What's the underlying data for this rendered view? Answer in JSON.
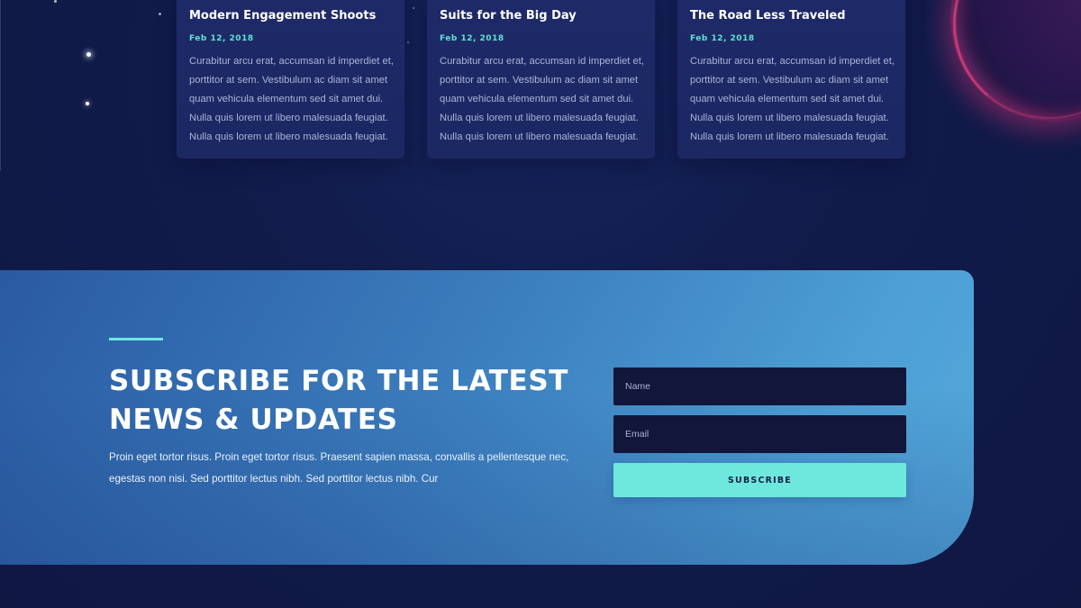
{
  "cards": [
    {
      "title": "Modern Engagement Shoots",
      "date": "Feb 12, 2018",
      "text": "Curabitur arcu erat, accumsan id imperdiet et, porttitor at sem. Vestibulum ac diam sit amet quam vehicula elementum sed sit amet dui. Nulla quis lorem ut libero malesuada feugiat. Nulla quis lorem ut libero malesuada feugiat."
    },
    {
      "title": "Suits for the Big Day",
      "date": "Feb 12, 2018",
      "text": "Curabitur arcu erat, accumsan id imperdiet et, porttitor at sem. Vestibulum ac diam sit amet quam vehicula elementum sed sit amet dui. Nulla quis lorem ut libero malesuada feugiat. Nulla quis lorem ut libero malesuada feugiat."
    },
    {
      "title": "The Road Less Traveled",
      "date": "Feb 12, 2018",
      "text": "Curabitur arcu erat, accumsan id imperdiet et, porttitor at sem. Vestibulum ac diam sit amet quam vehicula elementum sed sit amet dui. Nulla quis lorem ut libero malesuada feugiat. Nulla quis lorem ut libero malesuada feugiat."
    }
  ],
  "subscribe": {
    "heading": "SUBSCRIBE FOR THE LATEST NEWS & UPDATES",
    "text": "Proin eget tortor risus. Proin eget tortor risus. Praesent sapien massa, convallis a pellentesque nec, egestas non nisi. Sed porttitor lectus nibh. Sed porttitor lectus nibh. Cur",
    "name_placeholder": "Name",
    "email_placeholder": "Email",
    "button_label": "SUBSCRIBE"
  },
  "colors": {
    "background": "#111b4a",
    "card": "#1e2a68",
    "accent": "#6ee8dc",
    "subscribe_gradient_start": "#2a5aa2",
    "subscribe_gradient_end": "#54aadc",
    "input_background": "#12163a"
  },
  "decorations": {
    "stars": "star-icon",
    "planet": "planet-graphic"
  }
}
